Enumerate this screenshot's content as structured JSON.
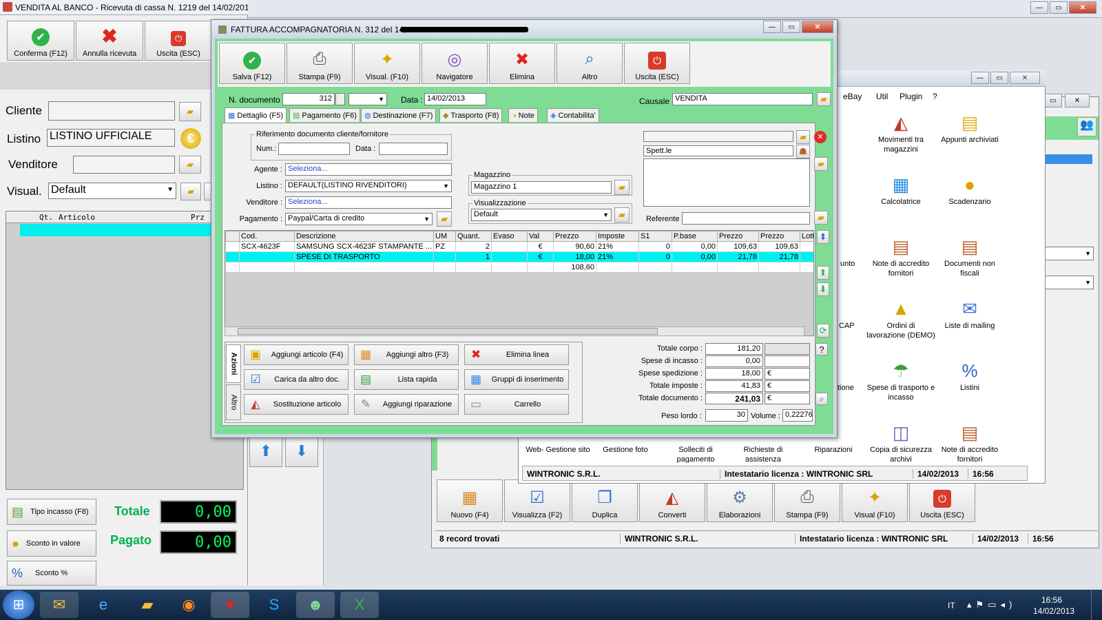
{
  "bg_window": {
    "title": "VENDITA AL BANCO - Ricevuta di cassa N. 1219 del 14/02/2013",
    "toolbar": [
      {
        "label": "Conferma (F12)",
        "icon": "check-icon"
      },
      {
        "label": "Annulla ricevuta",
        "icon": "x-icon"
      },
      {
        "label": "Uscita (ESC)",
        "icon": "exit-icon"
      }
    ],
    "cliente_label": "Cliente",
    "listino_label": "Listino",
    "listino_value": "LISTINO UFFICIALE",
    "venditore_label": "Venditore",
    "visual_label": "Visual.",
    "visual_value": "Default",
    "grid_headers": [
      "Qt.",
      "Articolo",
      "Prz"
    ],
    "tipo_incasso": "Tipo incasso (F8)",
    "sconto_valore": "Sconto in valore",
    "sconto_perc": "Sconto %",
    "totale_label": "Totale",
    "totale_value": "0,00",
    "pagato_label": "Pagato",
    "pagato_value": "0,00"
  },
  "main_window": {
    "title": "FATTURA ACCOMPAGNATORIA N. 312 del 14,",
    "toolbar": [
      {
        "label": "Salva (F12)",
        "icon": "check-icon"
      },
      {
        "label": "Stampa (F9)",
        "icon": "printer-icon"
      },
      {
        "label": "Visual. (F10)",
        "icon": "magic-wand-icon"
      },
      {
        "label": "Navigatore",
        "icon": "navigator-icon"
      },
      {
        "label": "Elimina",
        "icon": "x-icon"
      },
      {
        "label": "Altro",
        "icon": "magnifier-icon"
      },
      {
        "label": "Uscita (ESC)",
        "icon": "exit-icon"
      }
    ],
    "n_documento_label": "N. documento :",
    "n_documento_value": "312",
    "data_label": "Data :",
    "data_value": "14/02/2013",
    "causale_label": "Causale :",
    "causale_value": "VENDITA",
    "tabs": [
      "Dettaglio (F5)",
      "Pagamento (F6)",
      "Destinazione (F7)",
      "Trasporto (F8)",
      "Note",
      "Contabilita'"
    ],
    "rif_group": "Riferimento documento cliente/fornitore",
    "num_label": "Num.:",
    "data2_label": "Data :",
    "agente_label": "Agente :",
    "agente_value": "Seleziona...",
    "listino_label": "Listino :",
    "listino_value": "DEFAULT(LISTINO RIVENDITORI)",
    "venditore_label": "Venditore :",
    "venditore_value": "Seleziona...",
    "pagamento_label": "Pagamento :",
    "pagamento_value": "Paypal/Carta di credito",
    "magazzino_group": "Magazzino",
    "magazzino_value": "Magazzino 1",
    "visualizzazione_group": "Visualizzazione",
    "visualizzazione_value": "Default",
    "spett_value": "Spett.le",
    "referente_label": "Referente",
    "grid_headers": [
      "Cod.",
      "Descrizione",
      "UM",
      "Quant.",
      "Evaso",
      "Val",
      "Prezzo",
      "Imposte",
      "S1",
      "P.base",
      "Prezzo",
      "Prezzo",
      "Lott"
    ],
    "rows": [
      [
        "SCX-4623F",
        "SAMSUNG SCX-4623F STAMPANTE ...",
        "PZ",
        "2",
        "",
        "€",
        "90,60",
        "21%",
        "0",
        "0,00",
        "109,63",
        "109,63",
        ""
      ],
      [
        "",
        "SPESE DI TRASPORTO",
        "",
        "1",
        "",
        "€",
        "18,00",
        "21%",
        "0",
        "0,00",
        "21,78",
        "21,78",
        ""
      ]
    ],
    "grid_total": "108,60",
    "side_tabs": [
      "Azioni",
      "Altro"
    ],
    "actions": [
      "Aggiungi articolo (F4)",
      "Aggiungi altro (F3)",
      "Elimina linea",
      "Carica da altro doc.",
      "Lista rapida",
      "Gruppi di inserimento",
      "Sostituzione articolo",
      "Aggiungi riparazione",
      "Carrello"
    ],
    "totals": [
      {
        "label": "Totale corpo :",
        "value": "181,20",
        "unit": ""
      },
      {
        "label": "Spese di incasso :",
        "value": "0,00",
        "unit": ""
      },
      {
        "label": "Spese spedizione :",
        "value": "18,00",
        "unit": "€"
      },
      {
        "label": "Totale imposte :",
        "value": "41,83",
        "unit": "€"
      },
      {
        "label": "Totale documento :",
        "value": "241,03",
        "unit": "€"
      }
    ],
    "help_label": "?",
    "peso_label": "Peso lordo :",
    "peso_value": "30",
    "volume_label": "Volume :",
    "volume_value": "0,222768"
  },
  "menu_window": {
    "menu": [
      "eBay",
      "Util",
      "Plugin",
      "?"
    ],
    "icons": [
      {
        "label": "Movimenti tra magazzini",
        "icon": "shapes-icon"
      },
      {
        "label": "Appunti archiviati",
        "icon": "notes-icon"
      },
      {
        "label": "Calcolatrice",
        "icon": "calculator-icon"
      },
      {
        "label": "Scadenzario",
        "icon": "moneybag-icon"
      },
      {
        "label": "Note di accredito fornitori",
        "icon": "document-people-icon"
      },
      {
        "label": "Documenti non fiscali",
        "icon": "document-people-icon"
      },
      {
        "label": "Ordini di lavorazione (DEMO)",
        "icon": "bell-icon"
      },
      {
        "label": "Liste di mailing",
        "icon": "mail-icon"
      },
      {
        "label": "Spese di trasporto e incasso",
        "icon": "umbrella-icon"
      },
      {
        "label": "Listini",
        "icon": "percent-icon"
      },
      {
        "label": "Copia di sicurezza archivi",
        "icon": "database-icon"
      },
      {
        "label": "Note di accredito fornitori",
        "icon": "document-people-icon"
      }
    ],
    "partial_left": [
      "unto",
      "CAP",
      "tione"
    ],
    "bottom_row": [
      "Web- Gestione sito",
      "Gestione foto",
      "Solleciti di pagamento",
      "Richieste di assistenza",
      "Riparazioni"
    ],
    "status_company": "WINTRONIC S.R.L.",
    "status_license": "Intestatario licenza : WINTRONIC SRL",
    "status_date": "14/02/2013",
    "status_time": "16:56"
  },
  "list_window": {
    "toolbar": [
      {
        "label": "Nuovo (F4)",
        "icon": "grid-plus-icon"
      },
      {
        "label": "Visualizza (F2)",
        "icon": "grid-check-icon"
      },
      {
        "label": "Duplica",
        "icon": "duplicate-icon"
      },
      {
        "label": "Converti",
        "icon": "shapes-icon"
      },
      {
        "label": "Elaborazioni",
        "icon": "gear-doc-icon"
      },
      {
        "label": "Stampa (F9)",
        "icon": "printer-icon"
      },
      {
        "label": "Visual (F10)",
        "icon": "magic-wand-icon"
      },
      {
        "label": "Uscita (ESC)",
        "icon": "exit-icon"
      }
    ],
    "records": "8 record trovati",
    "status_company": "WINTRONIC S.R.L.",
    "status_license": "Intestatario licenza : WINTRONIC SRL",
    "status_date": "14/02/2013",
    "status_time": "16:56"
  },
  "taskbar": {
    "lang": "IT",
    "time": "16:56",
    "date": "14/02/2013"
  },
  "colors": {
    "accent_green": "#7fdc94",
    "selection_cyan": "#00f0f0",
    "lcd_green": "#00ff60"
  }
}
